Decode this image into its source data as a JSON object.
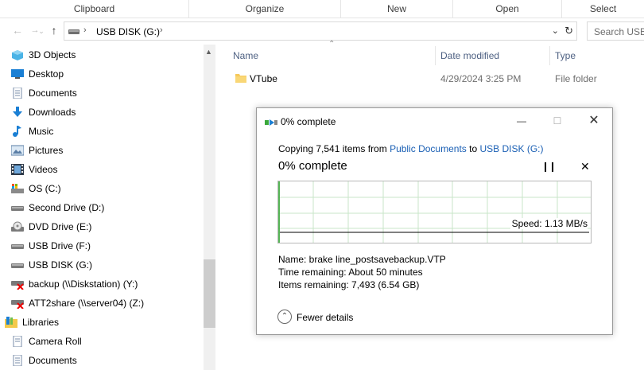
{
  "ribbon": {
    "groups": [
      "Clipboard",
      "Organize",
      "New",
      "Open",
      "Select"
    ]
  },
  "nav": {
    "address_path": "USB DISK (G:)",
    "search_placeholder": "Search USB"
  },
  "sidebar": {
    "items": [
      {
        "label": "3D Objects",
        "icon": "3d-objects-icon"
      },
      {
        "label": "Desktop",
        "icon": "desktop-icon"
      },
      {
        "label": "Documents",
        "icon": "documents-icon"
      },
      {
        "label": "Downloads",
        "icon": "downloads-icon"
      },
      {
        "label": "Music",
        "icon": "music-icon"
      },
      {
        "label": "Pictures",
        "icon": "pictures-icon"
      },
      {
        "label": "Videos",
        "icon": "videos-icon"
      },
      {
        "label": "OS (C:)",
        "icon": "os-drive-icon"
      },
      {
        "label": "Second Drive (D:)",
        "icon": "drive-icon"
      },
      {
        "label": "DVD Drive (E:)",
        "icon": "dvd-drive-icon"
      },
      {
        "label": "USB Drive (F:)",
        "icon": "drive-icon"
      },
      {
        "label": "USB DISK (G:)",
        "icon": "drive-icon"
      },
      {
        "label": "backup (\\\\Diskstation) (Y:)",
        "icon": "network-drive-disconnected-icon"
      },
      {
        "label": "ATT2share (\\\\server04) (Z:)",
        "icon": "network-drive-disconnected-icon"
      },
      {
        "label": "Libraries",
        "icon": "libraries-icon"
      },
      {
        "label": "Camera Roll",
        "icon": "camera-roll-icon"
      },
      {
        "label": "Documents",
        "icon": "documents-icon"
      }
    ]
  },
  "filelist": {
    "columns": {
      "name": "Name",
      "date": "Date modified",
      "type": "Type"
    },
    "rows": [
      {
        "name": "VTube",
        "date": "4/29/2024 3:25 PM",
        "type": "File folder"
      }
    ]
  },
  "dialog": {
    "title": "0% complete",
    "copy_prefix": "Copying 7,541 items from ",
    "copy_source": "Public Documents",
    "copy_mid": " to ",
    "copy_dest": "USB DISK (G:)",
    "percent": "0% complete",
    "progress_fraction": 0.0,
    "speed": "Speed: 1.13 MB/s",
    "name_line": "Name:  brake line_postsavebackup.VTP",
    "time_line": "Time remaining:  About 50 minutes",
    "items_line": "Items remaining:  7,493 (6.54 GB)",
    "fewer_details": "Fewer details"
  },
  "colors": {
    "accent_link": "#1a5fb4",
    "graph_grid": "#c8e6c9",
    "progress_green": "#3aa83a"
  }
}
